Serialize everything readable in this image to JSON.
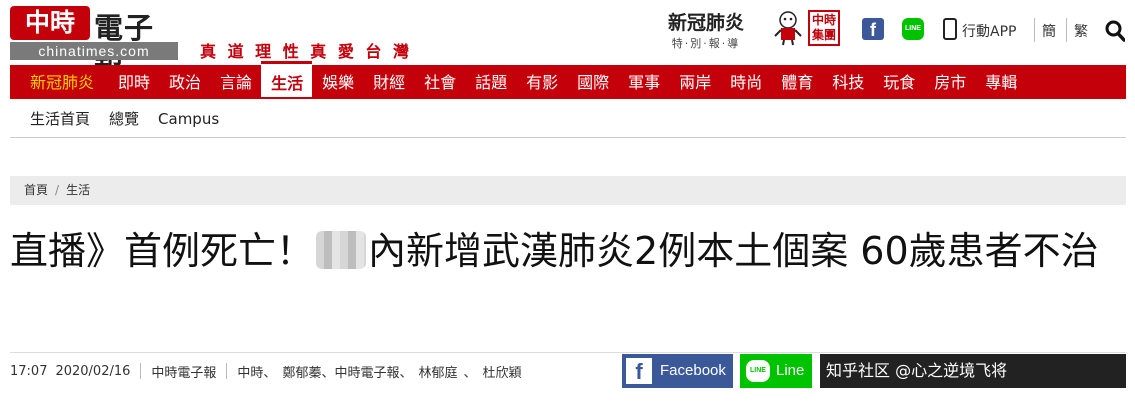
{
  "header": {
    "logo_badge": "中時",
    "logo_name": "電子報",
    "logo_domain": "chinatimes.com",
    "slogan": "真 道 理 性 真 愛 台 灣",
    "covid_title": "新冠肺炎",
    "covid_sub": "特·別·報·導",
    "group_logo": "中時集團",
    "app_label": "行動APP",
    "lang_trad": "簡",
    "lang_simp": "繁"
  },
  "nav": {
    "items": [
      "新冠肺炎",
      "即時",
      "政治",
      "言論",
      "生活",
      "娛樂",
      "財經",
      "社會",
      "話題",
      "有影",
      "國際",
      "軍事",
      "兩岸",
      "時尚",
      "體育",
      "科技",
      "玩食",
      "房市",
      "專輯"
    ],
    "active": "生活"
  },
  "subnav": {
    "items": [
      "生活首頁",
      "總覽",
      "Campus"
    ]
  },
  "breadcrumb": {
    "home": "首頁",
    "section": "生活"
  },
  "article": {
    "title_part1": "直播》首例死亡！",
    "title_part2": "內新增武漢肺炎2例本土個案 60歲患者不治",
    "time": "17:07",
    "date": "2020/02/16",
    "source": "中時電子報",
    "authors": [
      "中時、",
      "鄭郁蓁",
      "、中時電子報、",
      "林郁庭",
      "、",
      "杜欣穎"
    ]
  },
  "share": {
    "facebook": "Facebook",
    "line": "Line",
    "more": "知乎社区 @心之逆境飞将"
  },
  "colors": {
    "brand_red": "#c4000b",
    "facebook_blue": "#3b5998",
    "line_green": "#00c300"
  }
}
